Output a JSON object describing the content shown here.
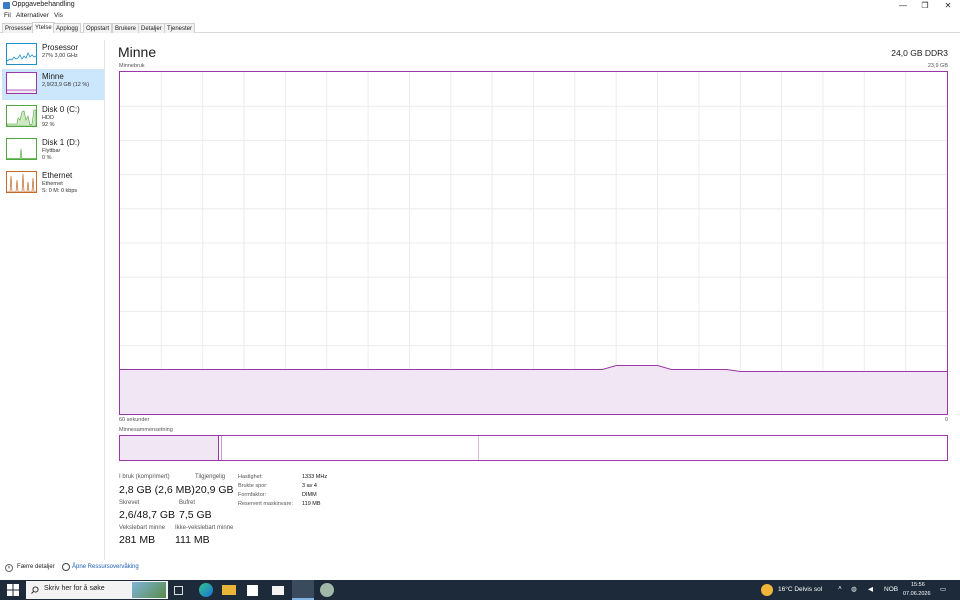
{
  "window": {
    "title": "Oppgavebehandling",
    "controls": {
      "minimize": "—",
      "maximize": "❐",
      "close": "✕"
    }
  },
  "menu": [
    "Fil",
    "Alternativer",
    "Vis"
  ],
  "tabs": [
    "Prosesser",
    "Ytelse",
    "Applogg",
    "Oppstart",
    "Brukere",
    "Detaljer",
    "Tjenester"
  ],
  "active_tab": "Ytelse",
  "sidebar": [
    {
      "name": "Prosessor",
      "line1": "27%  3,00 GHz",
      "line2": "",
      "color": "#1e90c8"
    },
    {
      "name": "Minne",
      "line1": "2,9/23,9 GB (12 %)",
      "line2": "",
      "color": "#9b37a8",
      "active": true
    },
    {
      "name": "Disk 0 (C:)",
      "line1": "HDD",
      "line2": "92 %",
      "color": "#4fa83d"
    },
    {
      "name": "Disk 1 (D:)",
      "line1": "Flyttbar",
      "line2": "0 %",
      "color": "#4fa83d"
    },
    {
      "name": "Ethernet",
      "line1": "Ethernet",
      "line2": "S: 0  M: 0 kbps",
      "color": "#c06a2b"
    }
  ],
  "main": {
    "title": "Minne",
    "spec": "24,0 GB DDR3",
    "usage_label": "Minnebruk",
    "max_label": "23,9 GB",
    "time_label": "60 sekunder",
    "zero_label": "0",
    "composition_label": "Minnesammensetning",
    "usage_fraction": 0.13
  },
  "stats": {
    "in_use_label": "I bruk (komprimert)",
    "in_use_value": "2,8 GB (2,6 MB)",
    "available_label": "Tilgjengelig",
    "available_value": "20,9 GB",
    "committed_label": "Skrevet",
    "committed_value": "2,6/48,7 GB",
    "cached_label": "Bufret",
    "cached_value": "7,5 GB",
    "paged_label": "Vekslebart minne",
    "paged_value": "281 MB",
    "nonpaged_label": "Ikke-vekslebart minne",
    "nonpaged_value": "111 MB"
  },
  "specs": [
    {
      "label": "Hastighet:",
      "value": "1333 MHz"
    },
    {
      "label": "Brukte spor:",
      "value": "3 av 4"
    },
    {
      "label": "Formfaktor:",
      "value": "DIMM"
    },
    {
      "label": "Reservert maskinvare:",
      "value": "119 MB"
    }
  ],
  "footer": {
    "fewer_details": "Færre detaljer",
    "open_monitor": "Åpne Ressursovervåking"
  },
  "taskbar": {
    "search_placeholder": "Skriv her for å søke",
    "weather": "16°C  Delvis sol",
    "lang": "NOB",
    "time": "15:56",
    "date": "07.06.2026"
  }
}
